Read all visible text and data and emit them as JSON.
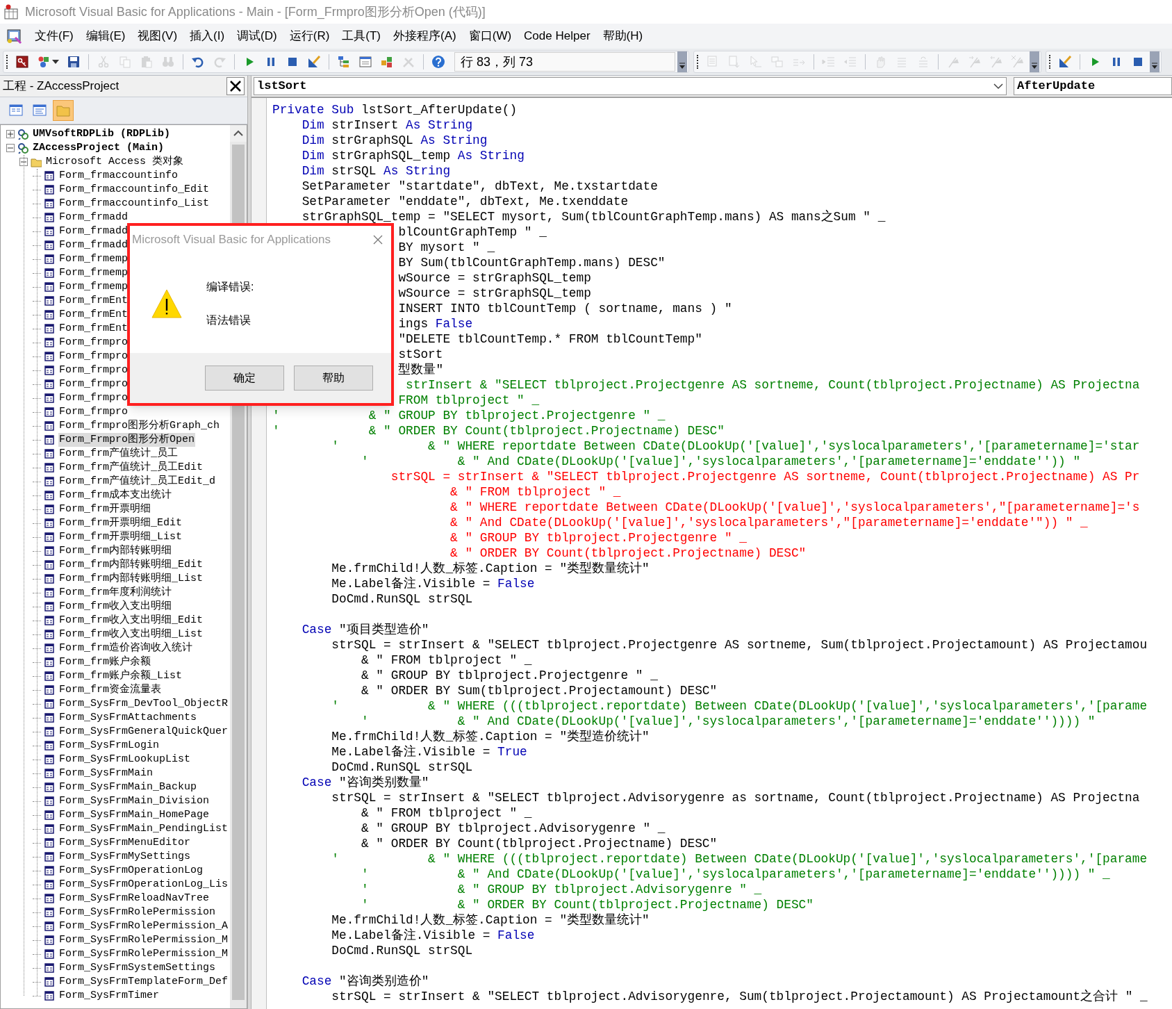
{
  "window": {
    "title": "Microsoft Visual Basic for Applications - Main - [Form_Frmpro图形分析Open (代码)]"
  },
  "menu": [
    "文件(F)",
    "编辑(E)",
    "视图(V)",
    "插入(I)",
    "调试(D)",
    "运行(R)",
    "工具(T)",
    "外接程序(A)",
    "窗口(W)",
    "Code Helper",
    "帮助(H)"
  ],
  "toolbars": [
    {
      "buttons": [
        {
          "kind": "access",
          "disabled": false
        },
        {
          "kind": "shapes",
          "disabled": false
        },
        {
          "kind": "save",
          "disabled": false
        },
        {
          "kind": "separator"
        },
        {
          "kind": "cut",
          "disabled": true
        },
        {
          "kind": "copy",
          "disabled": true
        },
        {
          "kind": "paste",
          "disabled": true
        },
        {
          "kind": "find",
          "disabled": true
        },
        {
          "kind": "separator"
        },
        {
          "kind": "undo",
          "disabled": false
        },
        {
          "kind": "redo",
          "disabled": true
        },
        {
          "kind": "separator"
        },
        {
          "kind": "run",
          "disabled": false
        },
        {
          "kind": "pause",
          "disabled": false
        },
        {
          "kind": "stop",
          "disabled": false
        },
        {
          "kind": "design",
          "disabled": false
        },
        {
          "kind": "separator"
        },
        {
          "kind": "project",
          "disabled": false
        },
        {
          "kind": "properties",
          "disabled": false
        },
        {
          "kind": "browser",
          "disabled": false
        },
        {
          "kind": "toolbox",
          "disabled": true
        },
        {
          "kind": "separator"
        },
        {
          "kind": "help",
          "disabled": false
        }
      ],
      "position": "行 83，列 73"
    },
    {
      "buttons": [
        {
          "kind": "list_properties",
          "disabled": true
        },
        {
          "kind": "list_constants",
          "disabled": true
        },
        {
          "kind": "quick_info",
          "disabled": true
        },
        {
          "kind": "parameter_info",
          "disabled": true
        },
        {
          "kind": "complete_word",
          "disabled": true
        },
        {
          "kind": "separator"
        },
        {
          "kind": "indent",
          "disabled": true
        },
        {
          "kind": "outdent",
          "disabled": true
        },
        {
          "kind": "separator"
        },
        {
          "kind": "breakpoint",
          "disabled": true
        },
        {
          "kind": "comment",
          "disabled": true
        },
        {
          "kind": "uncomment",
          "disabled": true
        },
        {
          "kind": "separator"
        },
        {
          "kind": "bookmark",
          "disabled": true
        },
        {
          "kind": "next_bookmark",
          "disabled": true
        },
        {
          "kind": "prev_bookmark",
          "disabled": true
        },
        {
          "kind": "clear_bookmarks",
          "disabled": true
        }
      ]
    },
    {
      "buttons": [
        {
          "kind": "design",
          "disabled": false
        },
        {
          "kind": "separator"
        },
        {
          "kind": "run",
          "disabled": false
        },
        {
          "kind": "pause",
          "disabled": false
        },
        {
          "kind": "stop",
          "disabled": false
        }
      ]
    }
  ],
  "project_explorer": {
    "title": "工程 - ZAccessProject",
    "buttons": [
      {
        "kind": "view_object",
        "selected": false
      },
      {
        "kind": "view_code",
        "selected": false
      },
      {
        "kind": "toggle_folders",
        "selected": true
      }
    ],
    "tree": [
      {
        "label": "UMVsoftRDPLib (RDPLib)",
        "kind": "project",
        "expanded": false,
        "selected": false
      },
      {
        "label": "ZAccessProject (Main)",
        "kind": "project",
        "expanded": true,
        "selected": false,
        "children": [
          {
            "label": "Microsoft Access 类对象",
            "kind": "folder",
            "expanded": true,
            "selected": false,
            "children": [
              {
                "label": "Form_frmaccountinfo",
                "kind": "form",
                "selected": false
              },
              {
                "label": "Form_frmaccountinfo_Edit",
                "kind": "form",
                "selected": false
              },
              {
                "label": "Form_frmaccountinfo_List",
                "kind": "form",
                "selected": false
              },
              {
                "label": "Form_frmadd",
                "kind": "form",
                "selected": false
              },
              {
                "label": "Form_frmadd",
                "kind": "form",
                "selected": false
              },
              {
                "label": "Form_frmadd",
                "kind": "form",
                "selected": false
              },
              {
                "label": "Form_frmemp",
                "kind": "form",
                "selected": false
              },
              {
                "label": "Form_frmemp",
                "kind": "form",
                "selected": false
              },
              {
                "label": "Form_frmemp",
                "kind": "form",
                "selected": false
              },
              {
                "label": "Form_frmEnt",
                "kind": "form",
                "selected": false
              },
              {
                "label": "Form_frmEnt",
                "kind": "form",
                "selected": false
              },
              {
                "label": "Form_frmEnt",
                "kind": "form",
                "selected": false
              },
              {
                "label": "Form_frmpro",
                "kind": "form",
                "selected": false
              },
              {
                "label": "Form_frmpro",
                "kind": "form",
                "selected": false
              },
              {
                "label": "Form_frmpro",
                "kind": "form",
                "selected": false
              },
              {
                "label": "Form_frmpro",
                "kind": "form",
                "selected": false
              },
              {
                "label": "Form_frmpro",
                "kind": "form",
                "selected": false
              },
              {
                "label": "Form_frmpro",
                "kind": "form",
                "selected": false
              },
              {
                "label": "Form_frmpro图形分析Graph_ch",
                "kind": "form",
                "selected": false
              },
              {
                "label": "Form_Frmpro图形分析Open",
                "kind": "form",
                "selected": true
              },
              {
                "label": "Form_frm产值统计_员工",
                "kind": "form",
                "selected": false
              },
              {
                "label": "Form_frm产值统计_员工Edit",
                "kind": "form",
                "selected": false
              },
              {
                "label": "Form_frm产值统计_员工Edit_d",
                "kind": "form",
                "selected": false
              },
              {
                "label": "Form_frm成本支出统计",
                "kind": "form",
                "selected": false
              },
              {
                "label": "Form_frm开票明细",
                "kind": "form",
                "selected": false
              },
              {
                "label": "Form_frm开票明细_Edit",
                "kind": "form",
                "selected": false
              },
              {
                "label": "Form_frm开票明细_List",
                "kind": "form",
                "selected": false
              },
              {
                "label": "Form_frm内部转账明细",
                "kind": "form",
                "selected": false
              },
              {
                "label": "Form_frm内部转账明细_Edit",
                "kind": "form",
                "selected": false
              },
              {
                "label": "Form_frm内部转账明细_List",
                "kind": "form",
                "selected": false
              },
              {
                "label": "Form_frm年度利润统计",
                "kind": "form",
                "selected": false
              },
              {
                "label": "Form_frm收入支出明细",
                "kind": "form",
                "selected": false
              },
              {
                "label": "Form_frm收入支出明细_Edit",
                "kind": "form",
                "selected": false
              },
              {
                "label": "Form_frm收入支出明细_List",
                "kind": "form",
                "selected": false
              },
              {
                "label": "Form_frm造价咨询收入统计",
                "kind": "form",
                "selected": false
              },
              {
                "label": "Form_frm账户余额",
                "kind": "form",
                "selected": false
              },
              {
                "label": "Form_frm账户余额_List",
                "kind": "form",
                "selected": false
              },
              {
                "label": "Form_frm资金流量表",
                "kind": "form",
                "selected": false
              },
              {
                "label": "Form_SysFrm_DevTool_ObjectR",
                "kind": "form",
                "selected": false
              },
              {
                "label": "Form_SysFrmAttachments",
                "kind": "form",
                "selected": false
              },
              {
                "label": "Form_SysFrmGeneralQuickQuer",
                "kind": "form",
                "selected": false
              },
              {
                "label": "Form_SysFrmLogin",
                "kind": "form",
                "selected": false
              },
              {
                "label": "Form_SysFrmLookupList",
                "kind": "form",
                "selected": false
              },
              {
                "label": "Form_SysFrmMain",
                "kind": "form",
                "selected": false
              },
              {
                "label": "Form_SysFrmMain_Backup",
                "kind": "form",
                "selected": false
              },
              {
                "label": "Form_SysFrmMain_Division",
                "kind": "form",
                "selected": false
              },
              {
                "label": "Form_SysFrmMain_HomePage",
                "kind": "form",
                "selected": false
              },
              {
                "label": "Form_SysFrmMain_PendingList",
                "kind": "form",
                "selected": false
              },
              {
                "label": "Form_SysFrmMenuEditor",
                "kind": "form",
                "selected": false
              },
              {
                "label": "Form_SysFrmMySettings",
                "kind": "form",
                "selected": false
              },
              {
                "label": "Form_SysFrmOperationLog",
                "kind": "form",
                "selected": false
              },
              {
                "label": "Form_SysFrmOperationLog_Lis",
                "kind": "form",
                "selected": false
              },
              {
                "label": "Form_SysFrmReloadNavTree",
                "kind": "form",
                "selected": false
              },
              {
                "label": "Form_SysFrmRolePermission",
                "kind": "form",
                "selected": false
              },
              {
                "label": "Form_SysFrmRolePermission_A",
                "kind": "form",
                "selected": false
              },
              {
                "label": "Form_SysFrmRolePermission_M",
                "kind": "form",
                "selected": false
              },
              {
                "label": "Form_SysFrmRolePermission_M",
                "kind": "form",
                "selected": false
              },
              {
                "label": "Form_SysFrmSystemSettings",
                "kind": "form",
                "selected": false
              },
              {
                "label": "Form_SysFrmTemplateForm_Def",
                "kind": "form",
                "selected": false
              },
              {
                "label": "Form_SysFrmTimer",
                "kind": "form",
                "selected": false
              }
            ]
          }
        ]
      }
    ]
  },
  "code_window": {
    "object": "lstSort",
    "procedure": "AfterUpdate",
    "lines": [
      {
        "kind": "code",
        "parts": [
          {
            "text": "Private Sub ",
            "keyword": true
          },
          {
            "text": "lstSort_AfterUpdate()",
            "keyword": false
          }
        ]
      },
      {
        "kind": "code",
        "parts": [
          {
            "text": "    Dim ",
            "keyword": true
          },
          {
            "text": "strInsert ",
            "keyword": false
          },
          {
            "text": "As String",
            "keyword": true
          }
        ]
      },
      {
        "kind": "code",
        "parts": [
          {
            "text": "    Dim ",
            "keyword": true
          },
          {
            "text": "strGraphSQL ",
            "keyword": false
          },
          {
            "text": "As String",
            "keyword": true
          }
        ]
      },
      {
        "kind": "code",
        "parts": [
          {
            "text": "    Dim ",
            "keyword": true
          },
          {
            "text": "strGraphSQL_temp ",
            "keyword": false
          },
          {
            "text": "As String",
            "keyword": true
          }
        ]
      },
      {
        "kind": "code",
        "parts": [
          {
            "text": "    Dim ",
            "keyword": true
          },
          {
            "text": "strSQL ",
            "keyword": false
          },
          {
            "text": "As String",
            "keyword": true
          }
        ]
      },
      {
        "kind": "code",
        "text": "    SetParameter \"startdate\", dbText, Me.txstartdate"
      },
      {
        "kind": "code",
        "text": "    SetParameter \"enddate\", dbText, Me.txenddate"
      },
      {
        "kind": "code",
        "text": "    strGraphSQL_temp = \"SELECT mysort, Sum(tblCountGraphTemp.mans) AS mans之Sum \" _"
      },
      {
        "kind": "code",
        "text": "                 blCountGraphTemp \" _"
      },
      {
        "kind": "code",
        "text": "                 BY mysort \" _"
      },
      {
        "kind": "code",
        "text": "                 BY Sum(tblCountGraphTemp.mans) DESC\""
      },
      {
        "kind": "code",
        "text": "                 wSource = strGraphSQL_temp"
      },
      {
        "kind": "code",
        "text": "                 wSource = strGraphSQL_temp"
      },
      {
        "kind": "code",
        "text": "                 INSERT INTO tblCountTemp ( sortname, mans ) \""
      },
      {
        "kind": "code",
        "parts": [
          {
            "text": "                 ings ",
            "keyword": false
          },
          {
            "text": "False",
            "keyword": true
          }
        ]
      },
      {
        "kind": "code",
        "text": "                 \"DELETE tblCountTemp.* FROM tblCountTemp\""
      },
      {
        "kind": "code",
        "text": "                 stSort"
      },
      {
        "kind": "code",
        "text": "                 型数量\""
      },
      {
        "kind": "comment",
        "text": "                  strInsert & \"SELECT tblproject.Projectgenre AS sortneme, Count(tblproject.Projectname) AS Projectna"
      },
      {
        "kind": "comment",
        "text": "                 FROM tblproject \" _"
      },
      {
        "kind": "comment",
        "text": "'            & \" GROUP BY tblproject.Projectgenre \" _"
      },
      {
        "kind": "comment",
        "text": "'            & \" ORDER BY Count(tblproject.Projectname) DESC\""
      },
      {
        "kind": "comment",
        "text": "        '            & \" WHERE reportdate Between CDate(DLookUp('[value]','syslocalparameters','[parametername]='star"
      },
      {
        "kind": "comment",
        "text": "            '            & \" And CDate(DLookUp('[value]','syslocalparameters','[parametername]='enddate'')) \""
      },
      {
        "kind": "error",
        "text": "                strSQL = strInsert & \"SELECT tblproject.Projectgenre AS sortneme, Count(tblproject.Projectname) AS Pr"
      },
      {
        "kind": "error",
        "text": "                        & \" FROM tblproject \" _"
      },
      {
        "kind": "error",
        "text": "                        & \" WHERE reportdate Between CDate(DLookUp('[value]','syslocalparameters',\"[parametername]='s"
      },
      {
        "kind": "error",
        "text": "                        & \" And CDate(DLookUp('[value]','syslocalparameters',\"[parametername]='enddate'\")) \" _"
      },
      {
        "kind": "error",
        "text": "                        & \" GROUP BY tblproject.Projectgenre \" _"
      },
      {
        "kind": "error",
        "text": "                        & \" ORDER BY Count(tblproject.Projectname) DESC\""
      },
      {
        "kind": "code",
        "text": "        Me.frmChild!人数_标签.Caption = \"类型数量统计\""
      },
      {
        "kind": "code",
        "parts": [
          {
            "text": "        Me.Label备注.Visible = ",
            "keyword": false
          },
          {
            "text": "False",
            "keyword": true
          }
        ]
      },
      {
        "kind": "code",
        "text": "        DoCmd.RunSQL strSQL"
      },
      {
        "kind": "blank"
      },
      {
        "kind": "code",
        "parts": [
          {
            "text": "    Case ",
            "keyword": true
          },
          {
            "text": "\"项目类型造价\"",
            "keyword": false
          }
        ]
      },
      {
        "kind": "code",
        "text": "        strSQL = strInsert & \"SELECT tblproject.Projectgenre AS sortneme, Sum(tblproject.Projectamount) AS Projectamou"
      },
      {
        "kind": "code",
        "text": "            & \" FROM tblproject \" _"
      },
      {
        "kind": "code",
        "text": "            & \" GROUP BY tblproject.Projectgenre \" _"
      },
      {
        "kind": "code",
        "text": "            & \" ORDER BY Sum(tblproject.Projectamount) DESC\""
      },
      {
        "kind": "comment",
        "text": "        '            & \" WHERE (((tblproject.reportdate) Between CDate(DLookUp('[value]','syslocalparameters','[parame"
      },
      {
        "kind": "comment",
        "text": "            '            & \" And CDate(DLookUp('[value]','syslocalparameters','[parametername]='enddate'')))) \""
      },
      {
        "kind": "code",
        "text": "        Me.frmChild!人数_标签.Caption = \"类型造价统计\""
      },
      {
        "kind": "code",
        "parts": [
          {
            "text": "        Me.Label备注.Visible = ",
            "keyword": false
          },
          {
            "text": "True",
            "keyword": true
          }
        ]
      },
      {
        "kind": "code",
        "text": "        DoCmd.RunSQL strSQL"
      },
      {
        "kind": "code",
        "parts": [
          {
            "text": "    Case ",
            "keyword": true
          },
          {
            "text": "\"咨询类别数量\"",
            "keyword": false
          }
        ]
      },
      {
        "kind": "code",
        "text": "        strSQL = strInsert & \"SELECT tblproject.Advisorygenre as sortname, Count(tblproject.Projectname) AS Projectna"
      },
      {
        "kind": "code",
        "text": "            & \" FROM tblproject \" _"
      },
      {
        "kind": "code",
        "text": "            & \" GROUP BY tblproject.Advisorygenre \" _"
      },
      {
        "kind": "code",
        "text": "            & \" ORDER BY Count(tblproject.Projectname) DESC\""
      },
      {
        "kind": "comment",
        "text": "        '            & \" WHERE (((tblproject.reportdate) Between CDate(DLookUp('[value]','syslocalparameters','[parame"
      },
      {
        "kind": "comment",
        "text": "            '            & \" And CDate(DLookUp('[value]','syslocalparameters','[parametername]='enddate'')))) \" _"
      },
      {
        "kind": "comment",
        "text": "            '            & \" GROUP BY tblproject.Advisorygenre \" _"
      },
      {
        "kind": "comment",
        "text": "            '            & \" ORDER BY Count(tblproject.Projectname) DESC\""
      },
      {
        "kind": "code",
        "text": "        Me.frmChild!人数_标签.Caption = \"类型数量统计\""
      },
      {
        "kind": "code",
        "parts": [
          {
            "text": "        Me.Label备注.Visible = ",
            "keyword": false
          },
          {
            "text": "False",
            "keyword": true
          }
        ]
      },
      {
        "kind": "code",
        "text": "        DoCmd.RunSQL strSQL"
      },
      {
        "kind": "blank"
      },
      {
        "kind": "code",
        "parts": [
          {
            "text": "    Case ",
            "keyword": true
          },
          {
            "text": "\"咨询类别造价\"",
            "keyword": false
          }
        ]
      },
      {
        "kind": "code",
        "text": "        strSQL = strInsert & \"SELECT tblproject.Advisorygenre, Sum(tblproject.Projectamount) AS Projectamount之合计 \" _"
      }
    ]
  },
  "dialog": {
    "title": "Microsoft Visual Basic for Applications",
    "heading": "编译错误:",
    "message": "语法错误",
    "buttons": [
      "确定",
      "帮助"
    ]
  }
}
